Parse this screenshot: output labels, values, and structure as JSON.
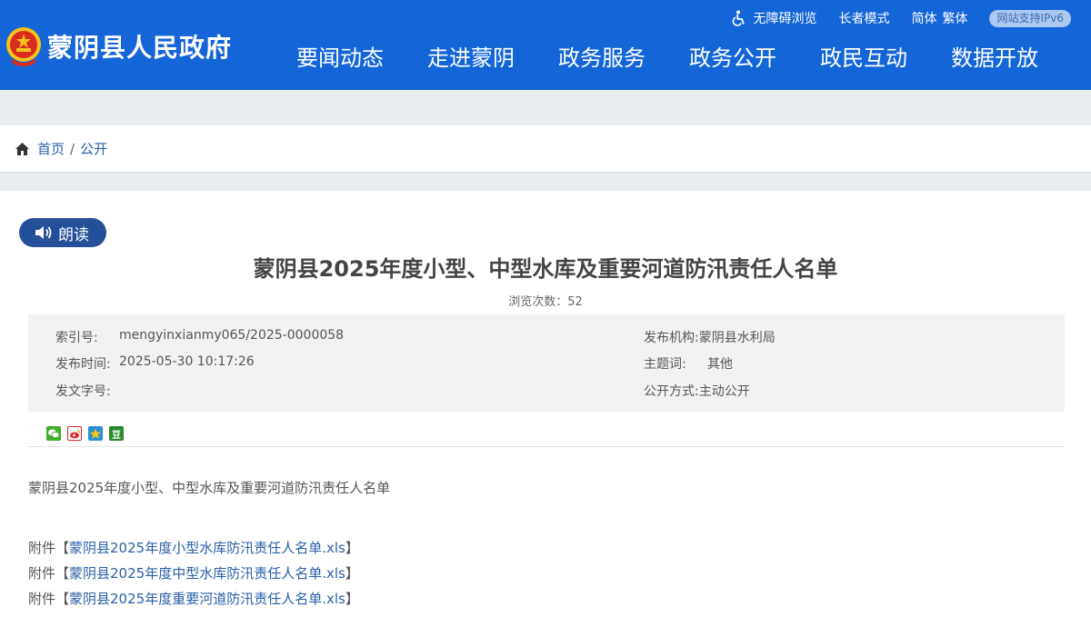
{
  "header": {
    "site_title": "蒙阴县人民政府",
    "links": {
      "accessibility": "无障碍浏览",
      "elder": "长者模式",
      "simplified": "简体",
      "traditional": "繁体",
      "ipv6": "网站支持IPv6"
    },
    "nav": [
      "要闻动态",
      "走进蒙阴",
      "政务服务",
      "政务公开",
      "政民互动",
      "数据开放"
    ],
    "colors": {
      "bar": "#1466d8"
    }
  },
  "breadcrumb": {
    "home": "首页",
    "separator": "/",
    "current": "公开"
  },
  "article": {
    "read_label": "朗读",
    "title": "蒙阴县2025年度小型、中型水库及重要河道防汛责任人名单",
    "views_label": "浏览次数：",
    "views": "52",
    "meta": {
      "index_label": "索引号:",
      "index_value": "mengyinxianmy065/2025-0000058",
      "publish_time_label": "发布时间:",
      "publish_time_value": "2025-05-30 10:17:26",
      "doc_no_label": "发文字号:",
      "doc_no_value": "",
      "org_label": "发布机构:",
      "org_value": "蒙阴县水利局",
      "topic_label": "主题词:",
      "topic_value": "其他",
      "open_label": "公开方式:",
      "open_value": "主动公开"
    },
    "share_icons": [
      "wechat-icon",
      "weibo-icon",
      "qzone-icon",
      "douban-icon"
    ],
    "douban_glyph": "豆",
    "body": "蒙阴县2025年度小型、中型水库及重要河道防汛责任人名单",
    "attachments": {
      "prefix": "附件【",
      "suffix": "】",
      "items": [
        "蒙阴县2025年度小型水库防汛责任人名单.xls",
        "蒙阴县2025年度中型水库防汛责任人名单.xls",
        "蒙阴县2025年度重要河道防汛责任人名单.xls"
      ]
    }
  }
}
